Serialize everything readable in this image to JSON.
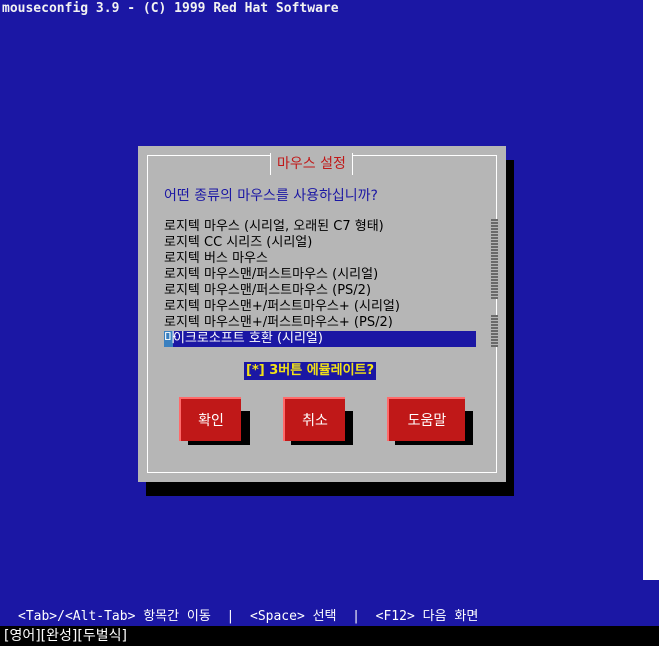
{
  "app": {
    "title": "mouseconfig 3.9 - (C) 1999 Red Hat Software"
  },
  "dialog": {
    "title": "마우스 설정",
    "question": "어떤 종류의 마우스를 사용하십니까?",
    "list": {
      "items": [
        "로지텍 마우스 (시리얼, 오래된 C7 형태)",
        "로지텍 CC 시리즈 (시리얼)",
        "로지텍 버스 마우스",
        "로지텍 마우스맨/퍼스트마우스 (시리얼)",
        "로지텍 마우스맨/퍼스트마우스 (PS/2)",
        "로지텍 마우스맨+/퍼스트마우스+ (시리얼)",
        "로지텍 마우스맨+/퍼스트마우스+ (PS/2)"
      ],
      "selected_first_char": "마",
      "selected_rest": "이크로소프트 호환 (시리얼)"
    },
    "checkbox": {
      "label": "[*] 3버튼 에뮬레이트?",
      "checked": true
    },
    "buttons": {
      "ok": "확인",
      "cancel": "취소",
      "help": "도움말"
    }
  },
  "footer": {
    "hint": "<Tab>/<Alt-Tab> 항목간 이동  |  <Space> 선택  |  <F12> 다음 화면"
  },
  "ime": {
    "status": "[영어][완성][두벌식]"
  },
  "colors": {
    "background": "#1b17a4",
    "dialog": "#b6b6b6",
    "accent": "#c01818",
    "highlight": "#f2e218"
  }
}
